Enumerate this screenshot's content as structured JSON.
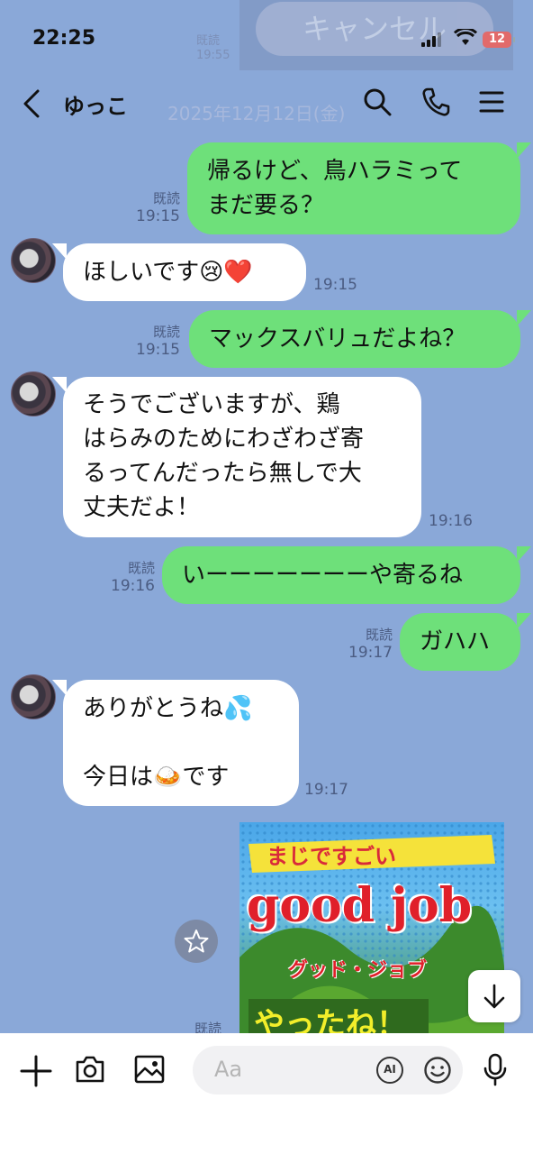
{
  "status": {
    "time": "22:25",
    "battery": "12"
  },
  "ghost_overlay": {
    "cancel_label": "キャンセル",
    "read_label": "既読",
    "time_partial": "19:55",
    "date": "2025年12月12日(金)"
  },
  "header": {
    "title": "ゆっこ"
  },
  "messages": [
    {
      "side": "mine",
      "lines": [
        "帰るけど、鳥ハラミって",
        "まだ要る？"
      ],
      "read": "既読",
      "time": "19:15"
    },
    {
      "side": "theirs",
      "text": "ほしいです😢❤️",
      "time": "19:15"
    },
    {
      "side": "mine",
      "text": "マックスバリュだよね？",
      "read": "既読",
      "time": "19:15"
    },
    {
      "side": "theirs",
      "lines": [
        "そうでございますが、鶏",
        "はらみのためにわざわざ寄",
        "るってんだったら無しで大",
        "丈夫だよ！"
      ],
      "time": "19:16"
    },
    {
      "side": "mine",
      "text": "いーーーーーーーや寄るね",
      "read": "既読",
      "time": "19:16"
    },
    {
      "side": "mine",
      "text": "ガハハ",
      "read": "既読",
      "time": "19:17"
    },
    {
      "side": "theirs",
      "lines": [
        "ありがとうね💦",
        "",
        "今日は🍛です"
      ],
      "time": "19:17"
    }
  ],
  "sticker": {
    "line1": "まじですごい",
    "line2": "good job",
    "line3": "グッド・ジョブ",
    "line4": "やったね！",
    "read": "既読"
  },
  "input": {
    "placeholder": "Aa",
    "ai_label": "AI"
  },
  "colors": {
    "background": "#8aa8d8",
    "mine_bubble": "#6ee07a",
    "theirs_bubble": "#ffffff"
  }
}
